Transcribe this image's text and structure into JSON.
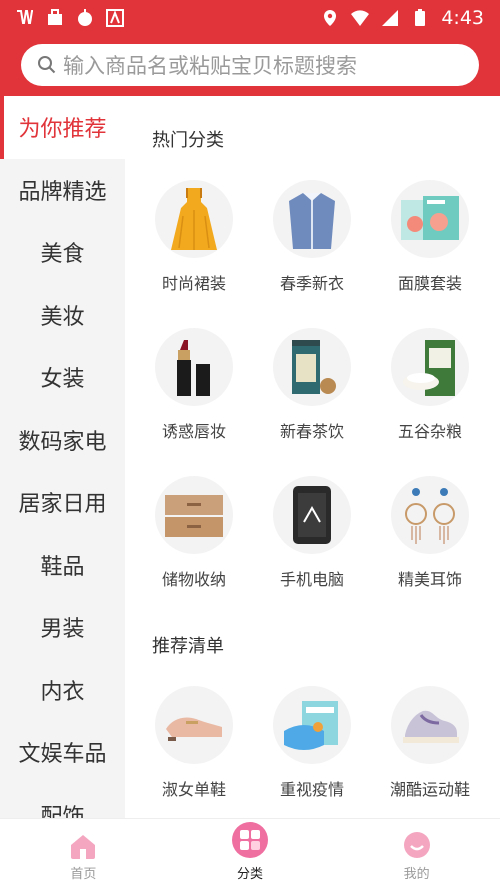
{
  "status": {
    "time": "4:43"
  },
  "search": {
    "placeholder": "输入商品名或粘贴宝贝标题搜索"
  },
  "sidebar": {
    "items": [
      {
        "label": "为你推荐"
      },
      {
        "label": "品牌精选"
      },
      {
        "label": "美食"
      },
      {
        "label": "美妆"
      },
      {
        "label": "女装"
      },
      {
        "label": "数码家电"
      },
      {
        "label": "居家日用"
      },
      {
        "label": "鞋品"
      },
      {
        "label": "男装"
      },
      {
        "label": "内衣"
      },
      {
        "label": "文娱车品"
      },
      {
        "label": "配饰"
      }
    ]
  },
  "hot": {
    "title": "热门分类",
    "items": [
      {
        "label": "时尚裙装",
        "icon": "dress-icon"
      },
      {
        "label": "春季新衣",
        "icon": "shirt-icon"
      },
      {
        "label": "面膜套装",
        "icon": "facemask-box-icon"
      },
      {
        "label": "诱惑唇妆",
        "icon": "lipstick-icon"
      },
      {
        "label": "新春茶饮",
        "icon": "tea-can-icon"
      },
      {
        "label": "五谷杂粮",
        "icon": "rice-bag-icon"
      },
      {
        "label": "储物收纳",
        "icon": "drawer-box-icon"
      },
      {
        "label": "手机电脑",
        "icon": "phone-icon"
      },
      {
        "label": "精美耳饰",
        "icon": "earrings-icon"
      }
    ]
  },
  "recommend": {
    "title": "推荐清单",
    "items": [
      {
        "label": "淑女单鞋",
        "icon": "loafer-shoe-icon"
      },
      {
        "label": "重视疫情",
        "icon": "face-mask-icon"
      },
      {
        "label": "潮酷运动鞋",
        "icon": "sneaker-icon"
      }
    ]
  },
  "tabs": [
    {
      "label": "首页",
      "icon": "home-icon"
    },
    {
      "label": "分类",
      "icon": "category-icon"
    },
    {
      "label": "我的",
      "icon": "profile-icon"
    }
  ],
  "colors": {
    "accent": "#e0343a",
    "sidebar_bg": "#f4f4f4"
  }
}
